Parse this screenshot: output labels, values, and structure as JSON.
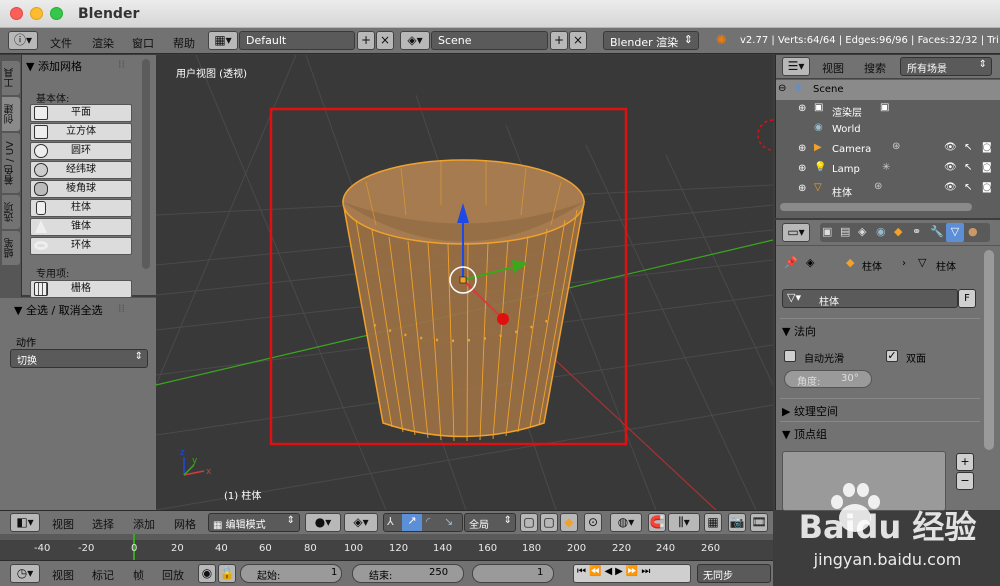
{
  "window": {
    "title": "Blender"
  },
  "info_header": {
    "menus": [
      "文件",
      "渲染",
      "窗口",
      "帮助"
    ],
    "layout": "Default",
    "scene": "Scene",
    "engine": "Blender 渲染",
    "stats": "v2.77 | Verts:64/64 | Edges:96/96 | Faces:32/32 | Tri"
  },
  "side_tabs": [
    "工具",
    "创建",
    "着色 / UV",
    "选项",
    "蜡笔"
  ],
  "tool_panel": {
    "header": "▼ 添加网格",
    "section_primitives": "基本体:",
    "primitives": [
      "平面",
      "立方体",
      "圆环",
      "经纬球",
      "棱角球",
      "柱体",
      "锥体",
      "环体"
    ],
    "section_special": "专用项:",
    "special": [
      "栅格"
    ]
  },
  "operator_panel": {
    "header": "▼ 全选 / 取消全选",
    "action_label": "动作",
    "action_value": "切换"
  },
  "viewport": {
    "view_label": "用户视图 (透视)",
    "object_label": "(1) 柱体"
  },
  "outliner": {
    "menus": [
      "视图",
      "搜索"
    ],
    "filter": "所有场景",
    "rows": [
      {
        "name": "Scene",
        "type": "scene"
      },
      {
        "name": "渲染层",
        "type": "renderlayer"
      },
      {
        "name": "World",
        "type": "world"
      },
      {
        "name": "Camera",
        "type": "camera"
      },
      {
        "name": "Lamp",
        "type": "lamp"
      },
      {
        "name": "柱体",
        "type": "mesh"
      }
    ]
  },
  "properties": {
    "breadcrumb_object": "柱体",
    "breadcrumb_data": "柱体",
    "datablock_name": "柱体",
    "fake_user": "F",
    "panel_normals": "▼ 法向",
    "auto_smooth_label": "自动光滑",
    "auto_smooth": false,
    "double_sided_label": "双面",
    "double_sided": true,
    "angle_label": "角度:",
    "angle_value": "30°",
    "panel_texture_space": "▶ 纹理空间",
    "panel_vertex_groups": "▼ 顶点组",
    "vg_add": "+",
    "vg_remove": "−"
  },
  "viewport_header": {
    "menus": [
      "视图",
      "选择",
      "添加",
      "网格"
    ],
    "mode": "编辑模式",
    "orientation": "全局"
  },
  "timeline": {
    "ticks": [
      "-40",
      "-20",
      "0",
      "20",
      "40",
      "60",
      "80",
      "100",
      "120",
      "140",
      "160",
      "180",
      "200",
      "220",
      "240",
      "260"
    ]
  },
  "timeline_header": {
    "menus": [
      "视图",
      "标记",
      "帧",
      "回放"
    ],
    "start_label": "起始:",
    "start_value": "1",
    "end_label": "结束:",
    "end_value": "250",
    "current": "1",
    "sync": "无同步"
  },
  "watermark": {
    "brand": "Baidu 经验",
    "url": "jingyan.baidu.com"
  },
  "colors": {
    "selection": "#f0a22c",
    "annotation_box": "#e01010",
    "x_axis": "#d83a3a",
    "y_axis": "#3aa81c",
    "z_axis": "#1e49e6"
  }
}
